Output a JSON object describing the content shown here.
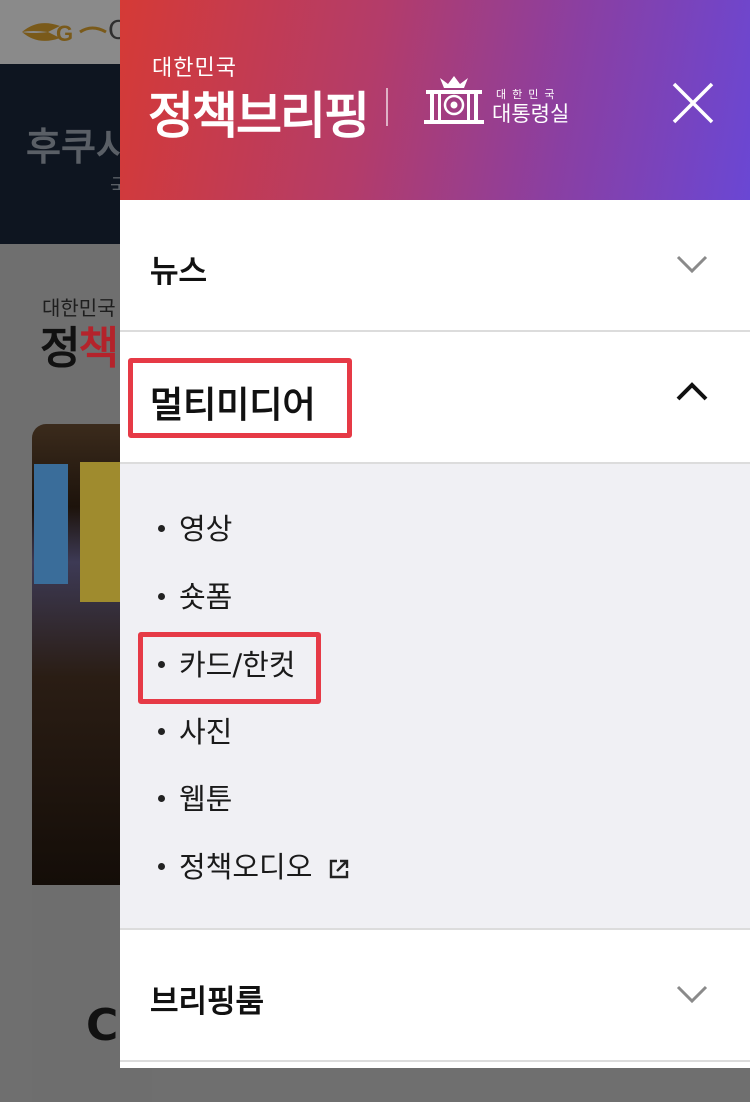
{
  "background": {
    "banner_title": "후쿠시",
    "banner_subtitle": "국",
    "brand_small": "대한민국",
    "brand_big_1": "정",
    "brand_big_2": "책",
    "card_text": "CO",
    "logo_letter": "C"
  },
  "drawer": {
    "brand_small": "대한민국",
    "brand_name": "정책브리핑",
    "office_small": "대한민국",
    "office_name": "대통령실",
    "close_icon": "close-icon"
  },
  "menu": {
    "news": {
      "label": "뉴스",
      "expanded": false
    },
    "multimedia": {
      "label": "멀티미디어",
      "expanded": true,
      "items": [
        {
          "label": "영상"
        },
        {
          "label": "숏폼"
        },
        {
          "label": "카드/한컷"
        },
        {
          "label": "사진"
        },
        {
          "label": "웹툰"
        },
        {
          "label": "정책오디오",
          "icon": "external-link-icon"
        }
      ]
    },
    "briefing": {
      "label": "브리핑룸",
      "expanded": false
    }
  },
  "colors": {
    "header_gradient_start": "#d53a36",
    "header_gradient_end": "#6a47d4",
    "highlight": "#e63a46"
  }
}
